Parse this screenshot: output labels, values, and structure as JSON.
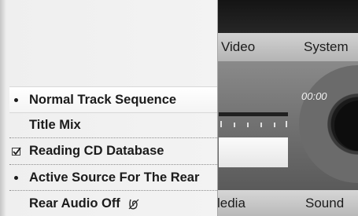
{
  "top_bar": {
    "video": "Video",
    "system": "System"
  },
  "media": {
    "time": "00:00"
  },
  "bottom_bar": {
    "media": "ledia",
    "sound": "Sound"
  },
  "menu": {
    "items": [
      {
        "label": "Normal Track Sequence",
        "mark": "bullet",
        "selected": true
      },
      {
        "label": "Title Mix",
        "mark": "none",
        "selected": false
      },
      {
        "label": "Reading CD Database",
        "mark": "checkbox-checked",
        "selected": false
      },
      {
        "label": "Active Source For The Rear",
        "mark": "bullet",
        "selected": false
      },
      {
        "label": "Rear Audio Off",
        "mark": "none",
        "selected": false,
        "trailing_icon": "rear-audio-off-icon"
      }
    ]
  }
}
